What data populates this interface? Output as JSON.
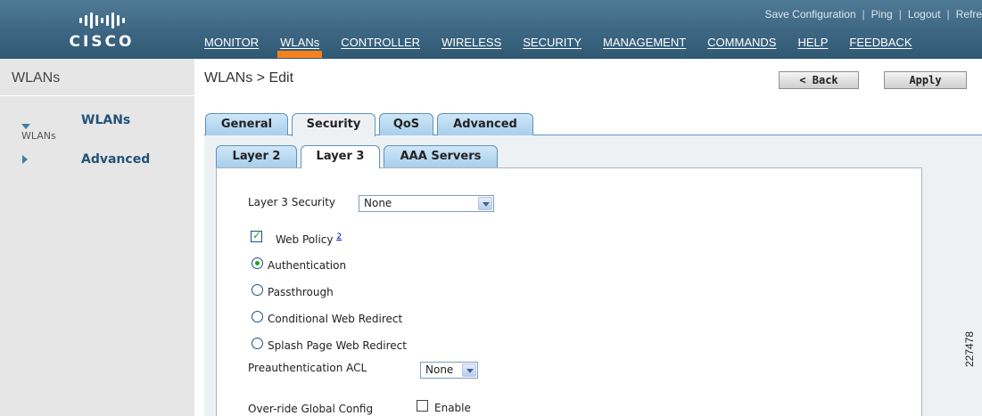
{
  "header": {
    "logo_text": "CISCO",
    "top_links": [
      "Save Configuration",
      "Ping",
      "Logout",
      "Refre"
    ],
    "menu": [
      "MONITOR",
      "WLANs",
      "CONTROLLER",
      "WIRELESS",
      "SECURITY",
      "MANAGEMENT",
      "COMMANDS",
      "HELP",
      "FEEDBACK"
    ],
    "active_menu": "WLANs"
  },
  "sidebar": {
    "title": "WLANs",
    "items": [
      {
        "label": "WLANs",
        "sub": "WLANs",
        "icon": "triangle-down-icon"
      },
      {
        "label": "Advanced",
        "icon": "triangle-right-icon"
      }
    ]
  },
  "main": {
    "title": "WLANs > Edit",
    "back_label": "< Back",
    "apply_label": "Apply",
    "tabs": [
      "General",
      "Security",
      "QoS",
      "Advanced"
    ],
    "selected_tab": "Security",
    "subtabs": [
      "Layer 2",
      "Layer 3",
      "AAA Servers"
    ],
    "selected_subtab": "Layer 3"
  },
  "form": {
    "layer3_security_label": "Layer 3 Security",
    "layer3_security_value": "None",
    "web_policy_label": "Web Policy",
    "web_policy_checked": true,
    "web_policy_footnote": "2",
    "radios": [
      {
        "label": "Authentication",
        "checked": true
      },
      {
        "label": "Passthrough",
        "checked": false
      },
      {
        "label": "Conditional Web Redirect",
        "checked": false
      },
      {
        "label": "Splash Page Web Redirect",
        "checked": false
      }
    ],
    "preauth_acl_label": "Preauthentication ACL",
    "preauth_acl_value": "None",
    "override_label": "Over-ride Global Config",
    "override_enable_label": "Enable",
    "override_checked": false
  },
  "figure_number": "227478",
  "colors": {
    "header_bg": "#3d6682",
    "active_tab_bar": "#f58220",
    "sidebar_bg": "#e6e6e6",
    "link_blue": "#22537a",
    "check_green": "#21a121"
  }
}
